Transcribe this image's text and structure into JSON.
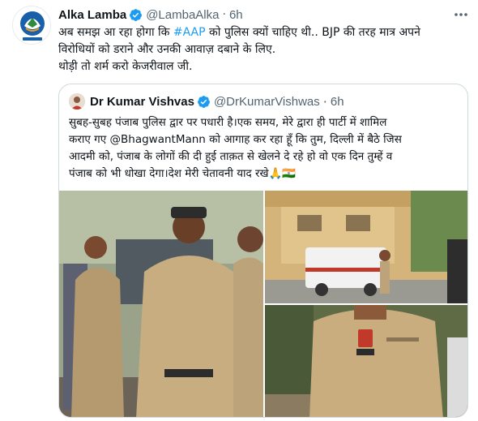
{
  "tweet": {
    "author_name": "Alka Lamba",
    "author_handle": "@LambaAlka",
    "time": "6h",
    "avatar_icon": "party-logo-icon",
    "text_lines": [
      {
        "pre": "अब समझ आ रहा होगा कि ",
        "link": "#AAP",
        "post": " को पुलिस क्यों चाहिए थी.. BJP की तरह मात्र अपने"
      },
      {
        "pre": "विरोधियों को डराने और उनकी आवाज़ दबाने के लिए.",
        "link": "",
        "post": ""
      },
      {
        "pre": "थोड़ी तो शर्म करो केजरीवाल जी.",
        "link": "",
        "post": ""
      }
    ],
    "link_color": "#1d9bf0"
  },
  "quote": {
    "author_name": "Dr Kumar Vishvas",
    "author_handle": "@DrKumarVishwas",
    "time": "6h",
    "text_lines": [
      "सुबह-सुबह पंजाब पुलिस द्वार पर पधारी है।एक समय, मेरे द्वारा ही पार्टी में शामिल",
      "कराए गए @BhagwantMann को आगाह कर रहा हूँ कि तुम, दिल्ली में बैठे जिस",
      "आदमी को, पंजाब के लोगों की दी हुई ताक़त से खेलने दे रहे हो वो एक दिन तुम्हें व",
      "पंजाब को भी धोखा देगा।देश मेरी चेतावनी याद रखे🙏🇮🇳"
    ],
    "media": [
      {
        "name": "policemen-photo",
        "icon": "photo"
      },
      {
        "name": "police-vehicle-photo",
        "icon": "photo"
      },
      {
        "name": "police-uniform-closeup-photo",
        "icon": "photo"
      }
    ]
  },
  "colors": {
    "verified": "#1d9bf0",
    "muted": "#536471",
    "border": "#cfd9de"
  },
  "icons": {
    "verified": "verified-badge-icon",
    "more": "more-options-icon"
  }
}
